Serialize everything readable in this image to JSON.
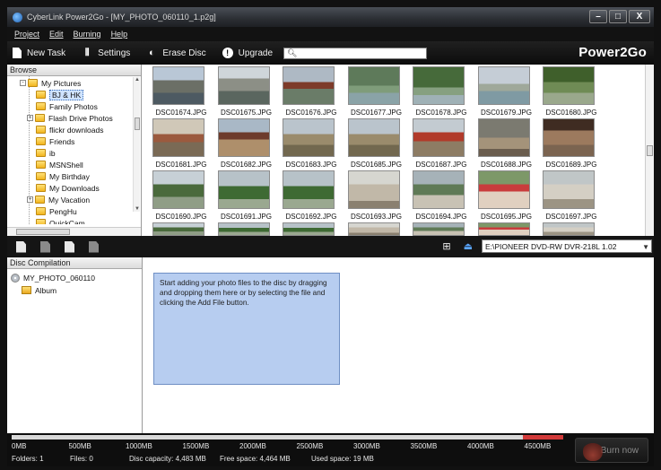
{
  "window": {
    "title": "CyberLink Power2Go - [MY_PHOTO_060110_1.p2g]",
    "buttons": {
      "minimize": "–",
      "maximize": "□",
      "close": "X"
    }
  },
  "menu": [
    "Project",
    "Edit",
    "Burning",
    "Help"
  ],
  "toolbar": {
    "new_task": "New Task",
    "settings": "Settings",
    "erase_disc": "Erase Disc",
    "upgrade": "Upgrade",
    "search_value": "",
    "brand": "Power2Go"
  },
  "browse": {
    "header": "Browse",
    "tree": [
      {
        "label": "My Pictures",
        "expander": "-",
        "selected": false
      },
      {
        "label": "BJ & HK",
        "expander": "",
        "selected": true
      },
      {
        "label": "Family Photos",
        "expander": "",
        "selected": false
      },
      {
        "label": "Flash Drive Photos",
        "expander": "+",
        "selected": false
      },
      {
        "label": "flickr downloads",
        "expander": "",
        "selected": false
      },
      {
        "label": "Friends",
        "expander": "",
        "selected": false
      },
      {
        "label": "ib",
        "expander": "",
        "selected": false
      },
      {
        "label": "MSNShell",
        "expander": "",
        "selected": false
      },
      {
        "label": "My Birthday",
        "expander": "",
        "selected": false
      },
      {
        "label": "My Downloads",
        "expander": "",
        "selected": false
      },
      {
        "label": "My Vacation",
        "expander": "+",
        "selected": false
      },
      {
        "label": "PengHu",
        "expander": "",
        "selected": false
      },
      {
        "label": "QuickCam",
        "expander": "",
        "selected": false
      }
    ],
    "thumbnails": [
      {
        "name": "DSC01674.JPG",
        "tone": "t-a"
      },
      {
        "name": "DSC01675.JPG",
        "tone": "t-b"
      },
      {
        "name": "DSC01676.JPG",
        "tone": "t-c"
      },
      {
        "name": "DSC01677.JPG",
        "tone": "t-d"
      },
      {
        "name": "DSC01678.JPG",
        "tone": "t-e"
      },
      {
        "name": "DSC01679.JPG",
        "tone": "t-f"
      },
      {
        "name": "DSC01680.JPG",
        "tone": "t-g"
      },
      {
        "name": "DSC01681.JPG",
        "tone": "t-h"
      },
      {
        "name": "DSC01682.JPG",
        "tone": "t-i"
      },
      {
        "name": "DSC01683.JPG",
        "tone": "t-j"
      },
      {
        "name": "DSC01685.JPG",
        "tone": "t-j"
      },
      {
        "name": "DSC01687.JPG",
        "tone": "t-k"
      },
      {
        "name": "DSC01688.JPG",
        "tone": "t-l"
      },
      {
        "name": "DSC01689.JPG",
        "tone": "t-m"
      },
      {
        "name": "DSC01690.JPG",
        "tone": "t-n"
      },
      {
        "name": "DSC01691.JPG",
        "tone": "t-o"
      },
      {
        "name": "DSC01692.JPG",
        "tone": "t-o"
      },
      {
        "name": "DSC01693.JPG",
        "tone": "t-p"
      },
      {
        "name": "DSC01694.JPG",
        "tone": "t-q"
      },
      {
        "name": "DSC01695.JPG",
        "tone": "t-r"
      },
      {
        "name": "DSC01697.JPG",
        "tone": "t-s"
      }
    ]
  },
  "drive": {
    "selected": "E:\\PIONEER DVD-RW DVR-218L 1.02"
  },
  "compilation": {
    "header": "Disc Compilation",
    "disc_name": "MY_PHOTO_060110",
    "album": "Album",
    "hint": "Start adding your photo files to the disc by dragging and dropping them here or by selecting the file and clicking the Add File button."
  },
  "capacity": {
    "ticks": [
      "0MB",
      "500MB",
      "1000MB",
      "1500MB",
      "2000MB",
      "2500MB",
      "3000MB",
      "3500MB",
      "4000MB",
      "4500MB"
    ],
    "used_fraction": 0.004,
    "status": {
      "folders": "Folders: 1",
      "files": "Files: 0",
      "disc_capacity": "Disc capacity: 4,483 MB",
      "free_space": "Free space: 4,464 MB",
      "used_space": "Used space: 19 MB"
    },
    "burn_label": "Burn now"
  },
  "colors": {
    "accent": "#5aa6ff",
    "drop_hint_bg": "#b7cdf0",
    "capacity_over": "#d23a3a"
  }
}
